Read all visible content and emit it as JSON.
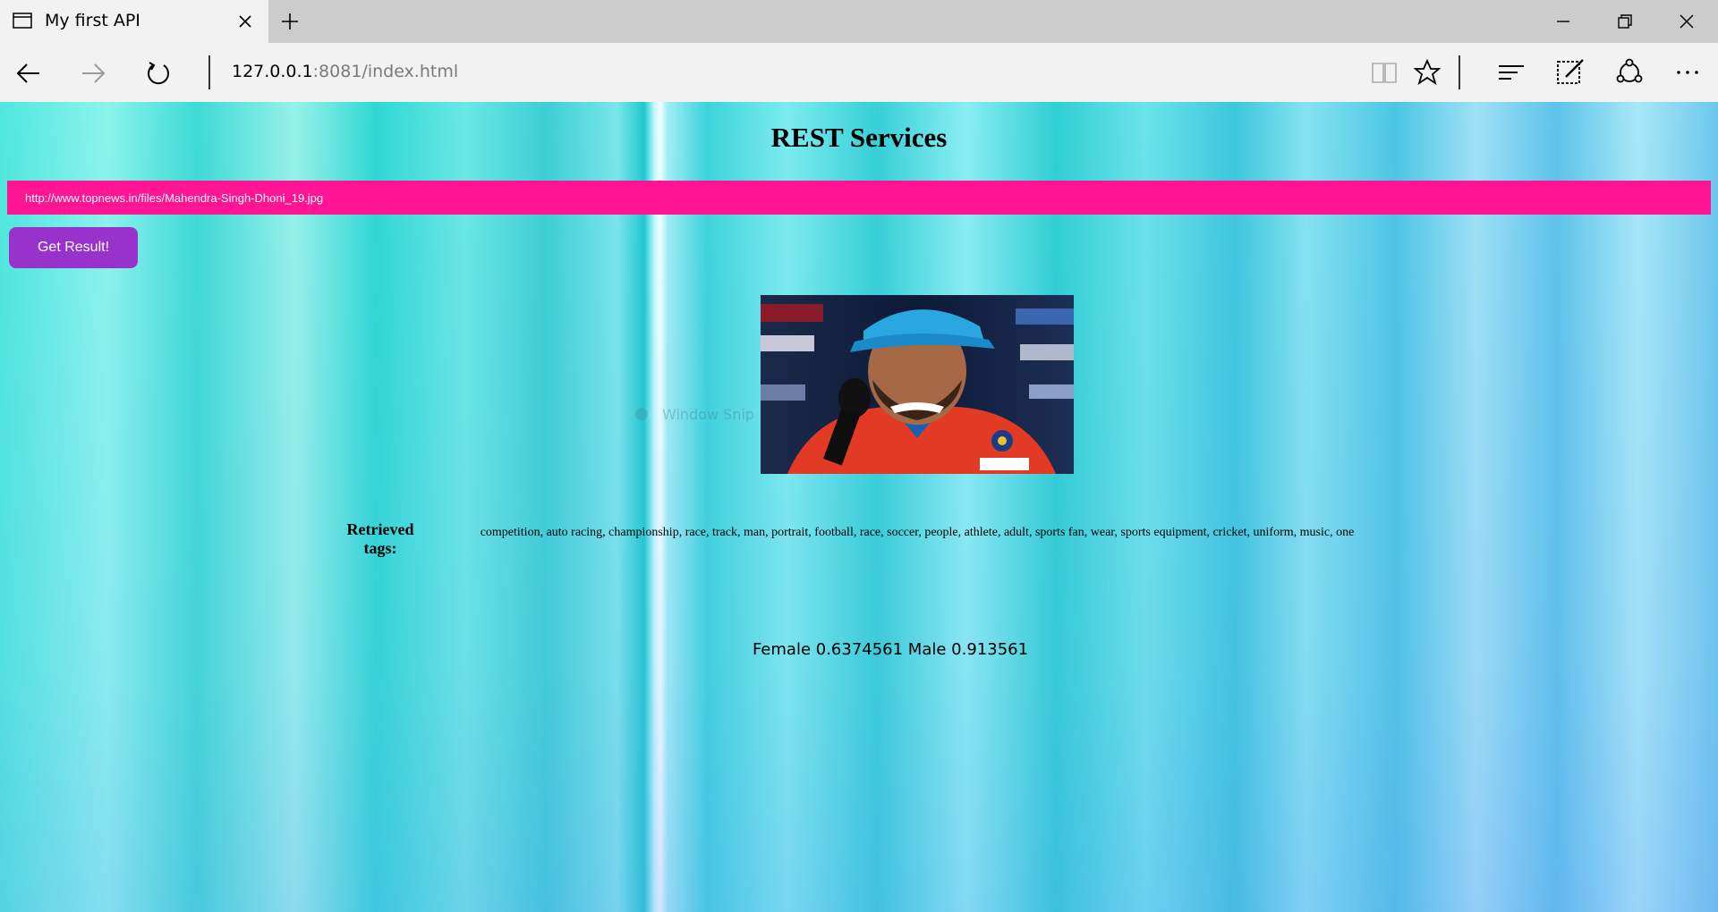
{
  "browser": {
    "tab_title": "My first API",
    "url_host": "127.0.0.1",
    "url_rest": ":8081/index.html"
  },
  "page": {
    "heading": "REST Services",
    "image_url_value": "http://www.topnews.in/files/Mahendra-Singh-Dhoni_19.jpg",
    "get_button_label": "Get Result!",
    "overlay_text": "Window Snip",
    "tags_label": "Retrieved tags:",
    "tags_value": "competition, auto racing, championship, race, track, man, portrait, football, race, soccer, people, athlete, adult, sports fan, wear, sports equipment, cricket, uniform, music, one",
    "gender_result": "Female 0.6374561 Male 0.913561"
  },
  "colors": {
    "url_bar_bg": "#ff1493",
    "button_bg": "#9932cc"
  },
  "icons": {
    "tab": "tab-page-icon",
    "close_tab": "close-icon",
    "new_tab": "plus-icon",
    "back": "back-arrow-icon",
    "forward": "forward-arrow-icon",
    "refresh": "refresh-icon",
    "reading_view": "book-icon",
    "favorite": "star-icon",
    "hub": "hub-lines-icon",
    "web_note": "pen-note-icon",
    "share": "share-icon",
    "more": "more-dots-icon"
  }
}
